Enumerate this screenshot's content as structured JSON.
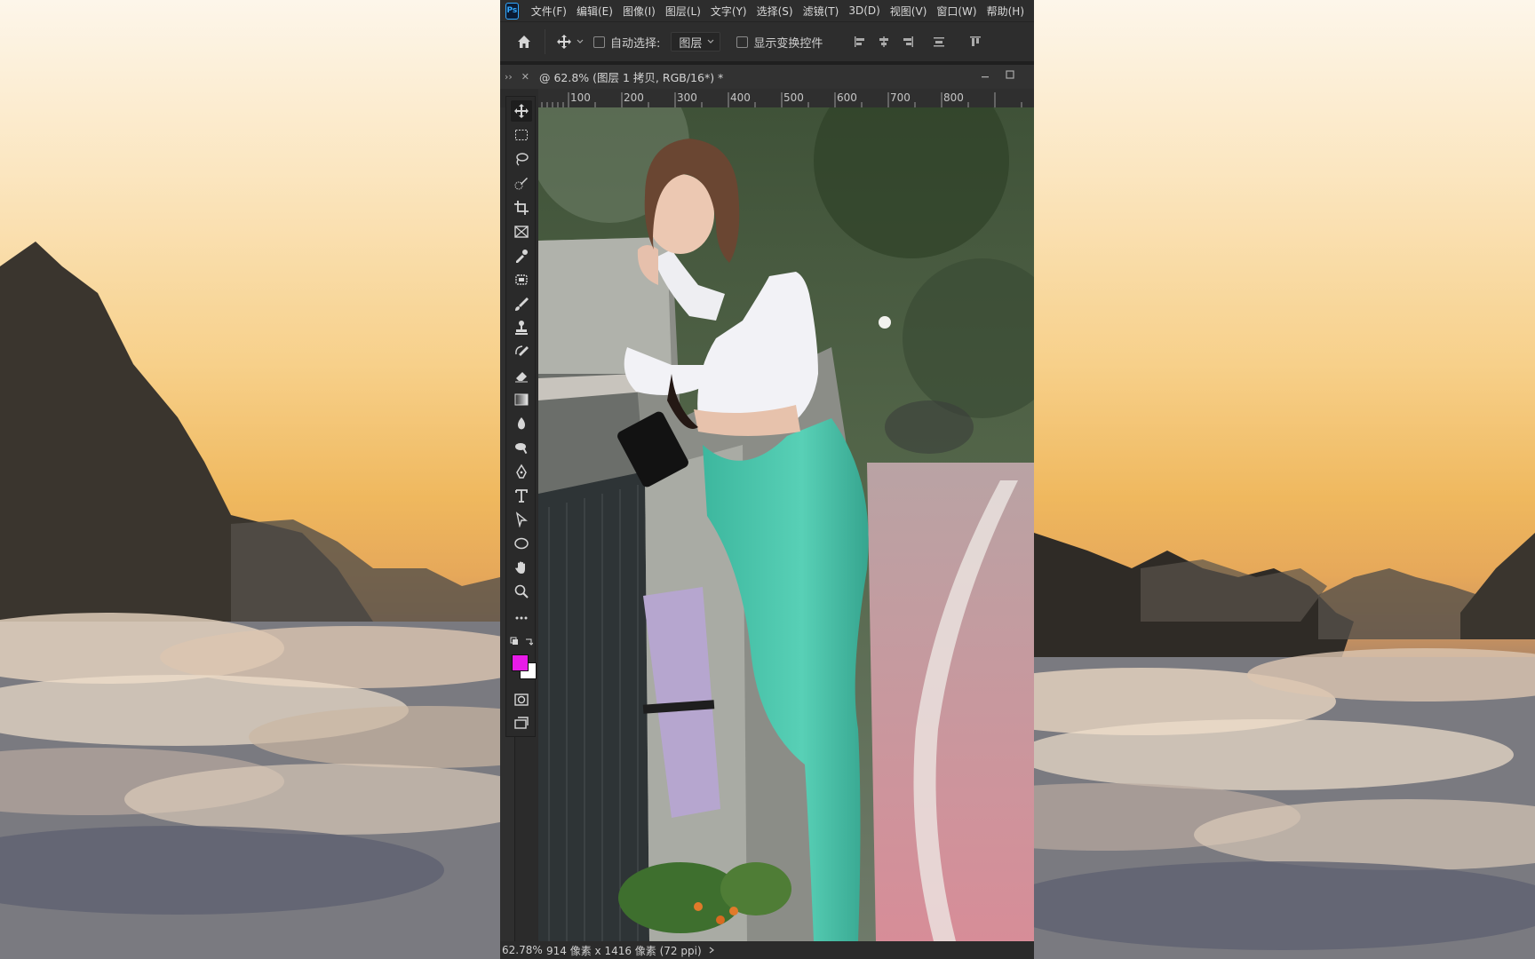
{
  "app": {
    "logo_text": "Ps"
  },
  "menu": [
    "文件(F)",
    "编辑(E)",
    "图像(I)",
    "图层(L)",
    "文字(Y)",
    "选择(S)",
    "滤镜(T)",
    "3D(D)",
    "视图(V)",
    "窗口(W)",
    "帮助(H)"
  ],
  "options": {
    "auto_select_label": "自动选择:",
    "auto_select_value": "图层",
    "show_transform_label": "显示变换控件"
  },
  "document": {
    "title": "@ 62.8% (图层 1 拷贝, RGB/16*) *",
    "ruler_marks": [
      "100",
      "200",
      "300",
      "400",
      "500",
      "600",
      "700",
      "800"
    ]
  },
  "colors": {
    "foreground": "#e81be8",
    "background": "#ffffff",
    "accent": "#31a8ff"
  },
  "tools": [
    "move-tool-icon",
    "marquee-tool-icon",
    "lasso-tool-icon",
    "quick-select-tool-icon",
    "crop-tool-icon",
    "frame-tool-icon",
    "eyedropper-tool-icon",
    "patch-tool-icon",
    "brush-tool-icon",
    "stamp-tool-icon",
    "history-brush-tool-icon",
    "eraser-tool-icon",
    "gradient-tool-icon",
    "blur-tool-icon",
    "dodge-tool-icon",
    "pen-tool-icon",
    "type-tool-icon",
    "path-select-tool-icon",
    "ellipse-tool-icon",
    "hand-tool-icon",
    "zoom-tool-icon",
    "more-tools-icon"
  ],
  "status": {
    "zoom": "62.78%",
    "dimensions": "914 像素 x 1416 像素 (72 ppi)"
  }
}
